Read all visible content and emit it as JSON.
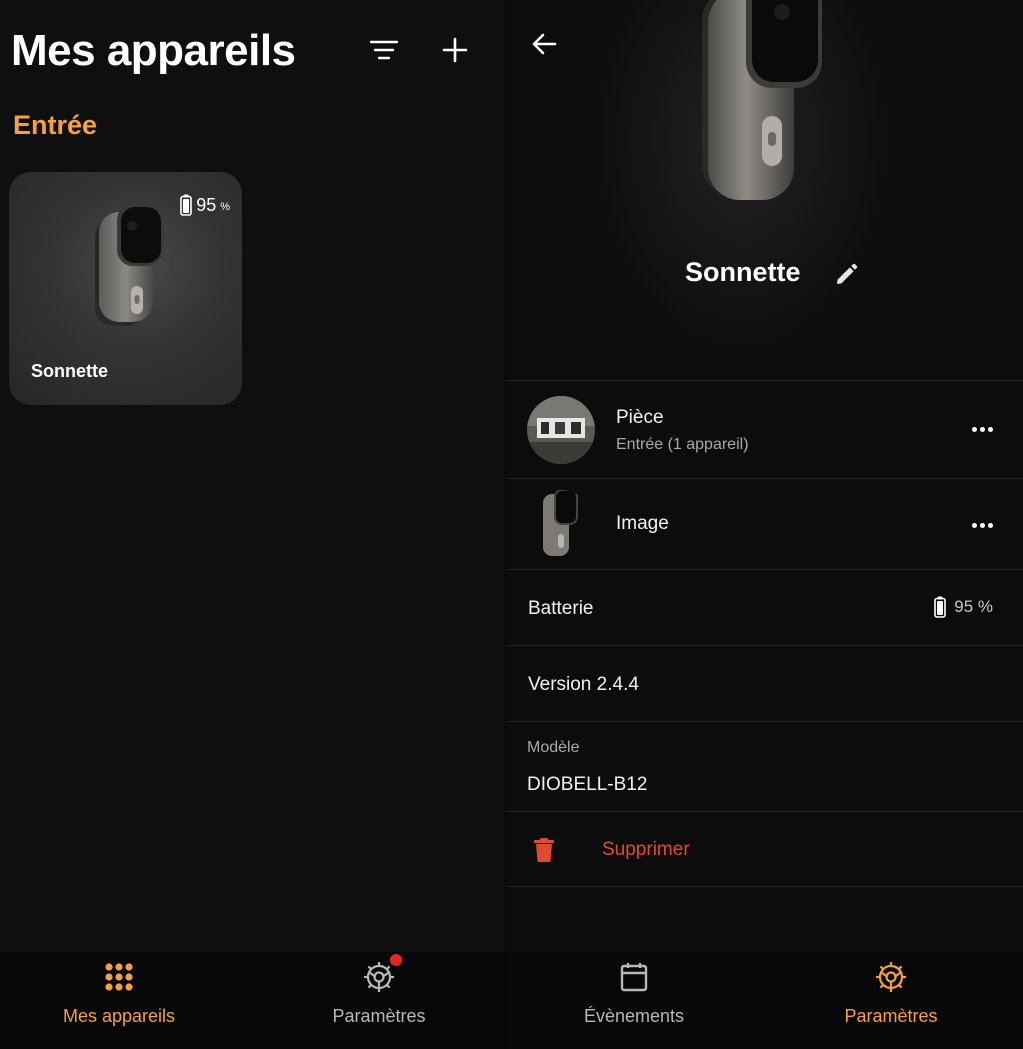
{
  "left": {
    "title": "Mes appareils",
    "section": "Entrée",
    "card": {
      "battery": "95",
      "battery_unit": "%",
      "name": "Sonnette"
    },
    "nav": [
      {
        "label": "Mes appareils",
        "icon": "grid-icon",
        "active": true
      },
      {
        "label": "Paramètres",
        "icon": "settings-icon",
        "active": false
      }
    ]
  },
  "right": {
    "device_name": "Sonnette",
    "room": {
      "label": "Pièce",
      "value": "Entrée (1 appareil)"
    },
    "image": {
      "label": "Image"
    },
    "battery": {
      "label": "Batterie",
      "value": "95 %"
    },
    "version": {
      "label": "Version 2.4.4"
    },
    "model": {
      "label": "Modèle",
      "value": "DIOBELL-B12"
    },
    "delete": {
      "label": "Supprimer"
    },
    "nav": [
      {
        "label": "Évènements",
        "icon": "calendar-icon",
        "active": false
      },
      {
        "label": "Paramètres",
        "icon": "settings-icon",
        "active": true
      }
    ]
  },
  "colors": {
    "accent": "#f5a13c",
    "danger": "#e24a2d",
    "notification_dot": "#e32727",
    "background": "#0f0f10"
  }
}
